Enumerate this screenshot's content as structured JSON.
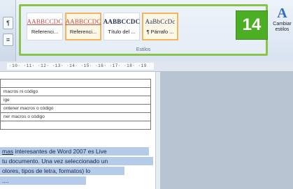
{
  "ribbon": {
    "styles": [
      {
        "sample": "AABBCCDC",
        "name": "Referenci...",
        "color": "#c0504d",
        "selected": false
      },
      {
        "sample": "AABBCCDC",
        "name": "Referenci...",
        "color": "#c0504d",
        "selected": true
      },
      {
        "sample": "AABBCCDC",
        "name": "Título del ...",
        "color": "#1f2f4a",
        "selected": false
      },
      {
        "sample": "AaBbCcDc",
        "name": "¶ Párrafo ...",
        "color": "#1f2f4a",
        "selected": true
      }
    ],
    "group_label": "Estilos",
    "badge": "14",
    "change_styles": {
      "line1": "Cambiar",
      "line2": "estilos"
    },
    "highlight_color": "#8bc34a"
  },
  "ruler": {
    "text": "·10· ·11· ·12· ·13· ·14· ·15· ·16· ·17· ·18· ·19"
  },
  "table_rows": [
    "",
    "macros ni código",
    "ige",
    "ontener macros o código",
    "ner macros o código",
    ""
  ],
  "paragraph": {
    "l1_link": "mas",
    "l1_rest": " interesantes de Word 2007 es Live",
    "l2": "tu documento. Una vez seleccionado un",
    "l3": "olores, tipos de letra, formatos) lo",
    "l4": "...."
  }
}
